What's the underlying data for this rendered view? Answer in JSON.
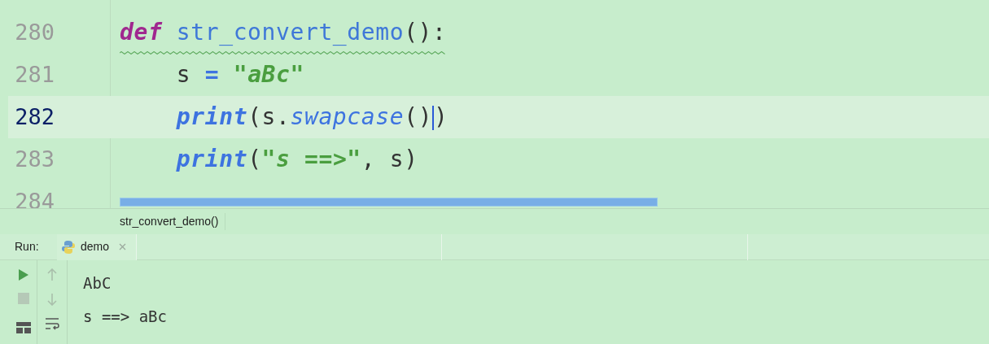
{
  "editor": {
    "lines": [
      {
        "number": "280",
        "current": false,
        "warning": true,
        "tokens": [
          {
            "text": "def",
            "kind": "keyword"
          },
          {
            "text": " str_convert_demo",
            "kind": "function"
          },
          {
            "text": "():",
            "kind": "plain"
          }
        ]
      },
      {
        "number": "281",
        "current": false,
        "warning": false,
        "tokens": [
          {
            "text": "    s ",
            "kind": "plain"
          },
          {
            "text": "=",
            "kind": "operator"
          },
          {
            "text": " \"aBc\"",
            "kind": "string"
          }
        ]
      },
      {
        "number": "282",
        "current": true,
        "warning": false,
        "tokens": [
          {
            "text": "    print",
            "kind": "builtin"
          },
          {
            "text": "(s.",
            "kind": "plain"
          },
          {
            "text": "swapcase",
            "kind": "method"
          },
          {
            "text": "()",
            "kind": "plain",
            "caret": true
          },
          {
            "text": ")",
            "kind": "plain"
          }
        ]
      },
      {
        "number": "283",
        "current": false,
        "warning": false,
        "tokens": [
          {
            "text": "    print",
            "kind": "builtin"
          },
          {
            "text": "(",
            "kind": "plain"
          },
          {
            "text": "\"s ==>\"",
            "kind": "string"
          },
          {
            "text": ", s)",
            "kind": "plain"
          }
        ]
      },
      {
        "number": "284",
        "current": false,
        "warning": false
      }
    ]
  },
  "breadcrumb": "str_convert_demo()",
  "run_panel": {
    "label": "Run:",
    "tabs": [
      {
        "label": "demo",
        "selected": true,
        "closable": true
      }
    ],
    "output": [
      "AbC",
      "s ==> aBc"
    ]
  }
}
